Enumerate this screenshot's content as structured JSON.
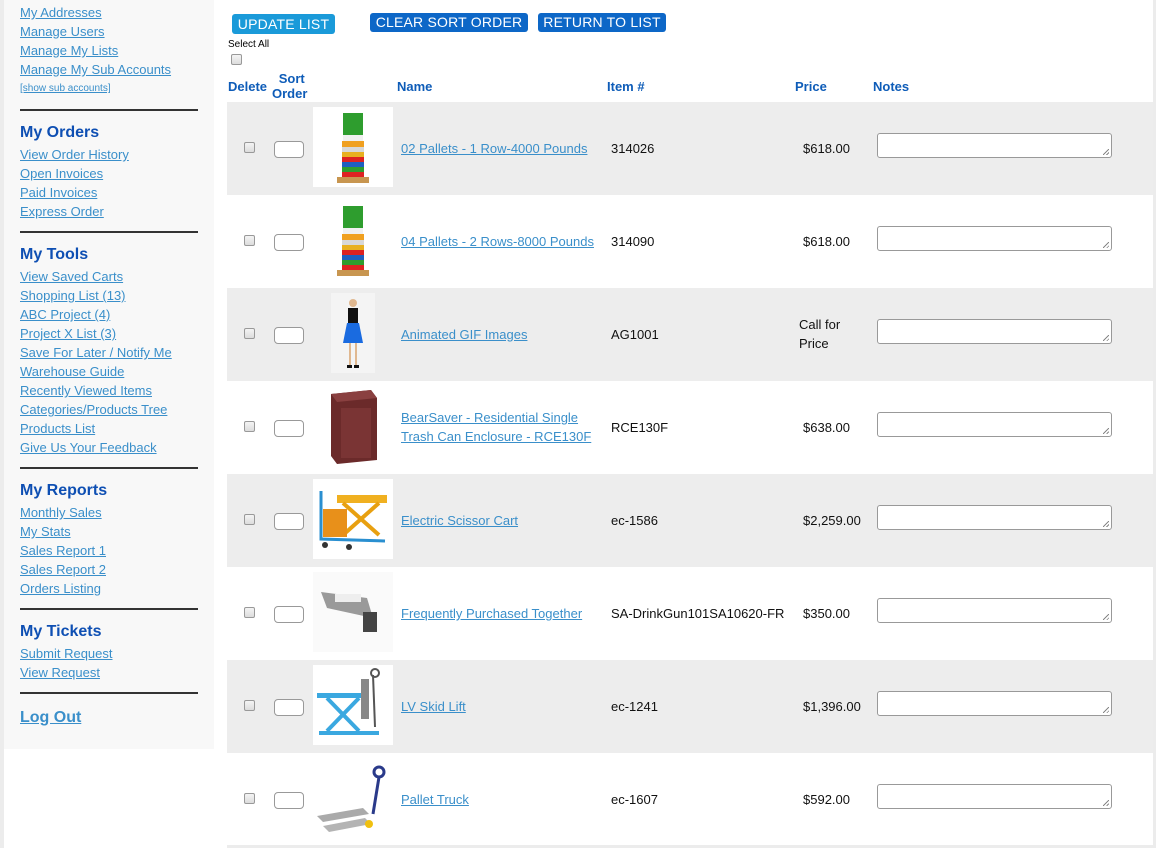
{
  "sidebar": {
    "account_links": [
      "My Addresses",
      "Manage Users",
      "Manage My Lists",
      "Manage My Sub Accounts"
    ],
    "show_sub_accounts": "[show sub accounts]",
    "orders": {
      "title": "My Orders",
      "links": [
        "View Order History",
        "Open Invoices",
        "Paid Invoices",
        "Express Order"
      ]
    },
    "tools": {
      "title": "My Tools",
      "links": [
        "View Saved Carts",
        "Shopping List (13)",
        "ABC Project (4)",
        "Project X List (3)",
        "Save For Later / Notify Me",
        "Warehouse Guide",
        "Recently Viewed Items",
        "Categories/Products Tree",
        "Products List",
        "Give Us Your Feedback"
      ]
    },
    "reports": {
      "title": "My Reports",
      "links": [
        "Monthly Sales",
        "My Stats",
        "Sales Report 1",
        "Sales Report 2",
        "Orders Listing"
      ]
    },
    "tickets": {
      "title": "My Tickets",
      "links": [
        "Submit Request",
        "View Request"
      ]
    },
    "logout": "Log Out"
  },
  "toolbar": {
    "update_label": "UPDATE LIST",
    "clear_label": "CLEAR SORT ORDER",
    "return_label": "RETURN TO LIST",
    "select_all": "Select All"
  },
  "colors": {
    "link": "#3a8fca",
    "heading": "#0e4fb3",
    "button_primary": "#0d67c7",
    "button_update": "#1a9ad9",
    "row_shade": "#ededed"
  },
  "table": {
    "headers": {
      "delete": "Delete",
      "sort_line1": "Sort",
      "sort_line2": "Order",
      "name": "Name",
      "item": "Item #",
      "price": "Price",
      "notes": "Notes"
    },
    "rows": [
      {
        "name": "02 Pallets - 1 Row-4000 Pounds",
        "item": "314026",
        "price": "$618.00",
        "thumb": "pallet-stack-image",
        "notes": ""
      },
      {
        "name": "04 Pallets - 2 Rows-8000 Pounds",
        "item": "314090",
        "price": "$618.00",
        "thumb": "pallet-stack-image",
        "notes": ""
      },
      {
        "name": "Animated GIF Images",
        "item": "AG1001",
        "price": "Call for Price",
        "thumb": "model-dress-image",
        "notes": ""
      },
      {
        "name": "BearSaver - Residential Single Trash Can Enclosure - RCE130F",
        "item": "RCE130F",
        "price": "$638.00",
        "thumb": "trash-enclosure-image",
        "notes": ""
      },
      {
        "name": "Electric Scissor Cart",
        "item": "ec-1586",
        "price": "$2,259.00",
        "thumb": "scissor-cart-image",
        "notes": ""
      },
      {
        "name": "Frequently Purchased Together",
        "item": "SA-DrinkGun101SA10620-FR",
        "price": "$350.00",
        "thumb": "drink-gun-image",
        "notes": ""
      },
      {
        "name": "LV Skid Lift",
        "item": "ec-1241",
        "price": "$1,396.00",
        "thumb": "skid-lift-image",
        "notes": ""
      },
      {
        "name": "Pallet Truck",
        "item": "ec-1607",
        "price": "$592.00",
        "thumb": "pallet-truck-image",
        "notes": ""
      }
    ]
  }
}
